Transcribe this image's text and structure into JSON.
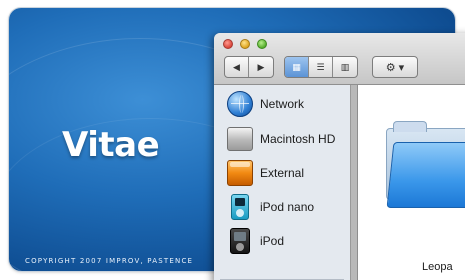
{
  "banner": {
    "title": "Vitae",
    "copyright": "COPYRIGHT 2007 IMPROV, PASTENCE"
  },
  "finder": {
    "toolbar": {
      "back_icon": "◀",
      "forward_icon": "▶",
      "view_icon_grid": "▦",
      "view_icon_list": "☰",
      "view_icon_columns": "▥",
      "action_icon": "⚙ ▾"
    },
    "sidebar": {
      "items": [
        {
          "label": "Network",
          "icon": "network-globe-icon"
        },
        {
          "label": "Macintosh HD",
          "icon": "hard-drive-icon"
        },
        {
          "label": "External",
          "icon": "external-drive-icon"
        },
        {
          "label": "iPod nano",
          "icon": "ipod-nano-icon"
        },
        {
          "label": "iPod",
          "icon": "ipod-icon"
        }
      ]
    },
    "content": {
      "folder_label": "Leopa"
    }
  },
  "colors": {
    "background_blue": "#1f6db8",
    "active_view": "#5b93d6",
    "folder_blue": "#3a97ea"
  }
}
